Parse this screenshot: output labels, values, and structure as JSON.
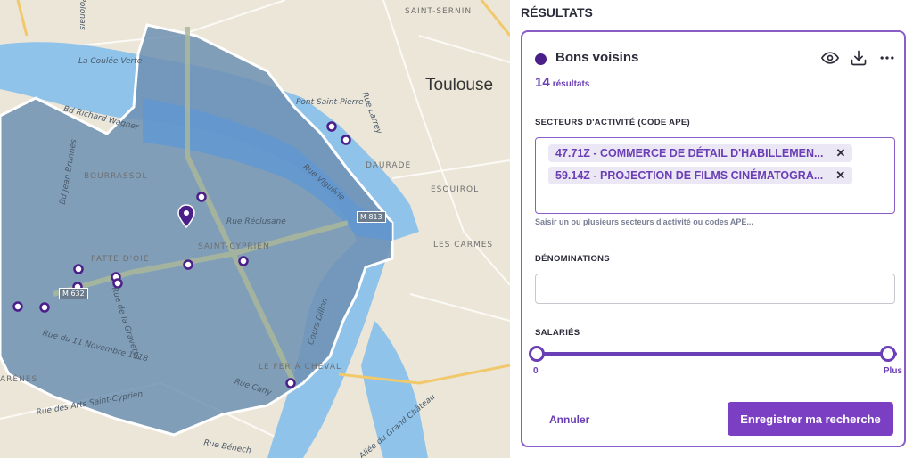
{
  "map": {
    "city_label": "Toulouse",
    "district_labels": [
      "BOURRASSOL",
      "SAINT-CYPRIEN",
      "PATTE D'OIE",
      "LE FER À CHEVAL",
      "DAURADE",
      "ESQUIROL",
      "LES CARMES",
      "SAINT-SERNIN",
      "ARÈNES"
    ],
    "street_labels": [
      "La Coulée Verte",
      "Bd Richard Wagner",
      "Rue Réclusane",
      "Rue Viguérie",
      "Rue du 11 Novembre 1918",
      "Rue de la Gravette",
      "Rue Cany",
      "Cours Dillon",
      "Rue Larrey",
      "Bd Jean Brunhes",
      "Rue des Arts Saint-Cyprien",
      "Rue Bénech",
      "Allée du Grand Château",
      "Pont Saint-Pierre",
      "Rue Polonais"
    ],
    "road_badges": [
      "M 632",
      "M 813"
    ],
    "colors": {
      "zone": "#6f90b3",
      "water": "#8fc3ea",
      "land": "#ece6d8",
      "marker": "#4a1f8a"
    }
  },
  "panel": {
    "results_heading": "RÉSULTATS",
    "search_name": "Bons voisins",
    "result_count": "14",
    "result_count_label": "résultats",
    "icons": {
      "view": "eye-icon",
      "download": "download-icon",
      "more": "more-icon"
    },
    "sectors_label": "SECTEURS D'ACTIVITÉ (CODE APE)",
    "sector_tags": [
      "47.71Z - COMMERCE DE DÉTAIL D'HABILLEMEN...",
      "59.14Z - PROJECTION DE FILMS CINÉMATOGRA..."
    ],
    "sectors_hint": "Saisir un ou plusieurs secteurs d'activité ou codes APE...",
    "names_label": "DÉNOMINATIONS",
    "names_value": "",
    "employees_label": "SALARIÉS",
    "employees_min": "0",
    "employees_max": "Plus",
    "cancel_label": "Annuler",
    "save_label": "Enregistrer ma recherche",
    "accent_color": "#7b3fc4"
  }
}
